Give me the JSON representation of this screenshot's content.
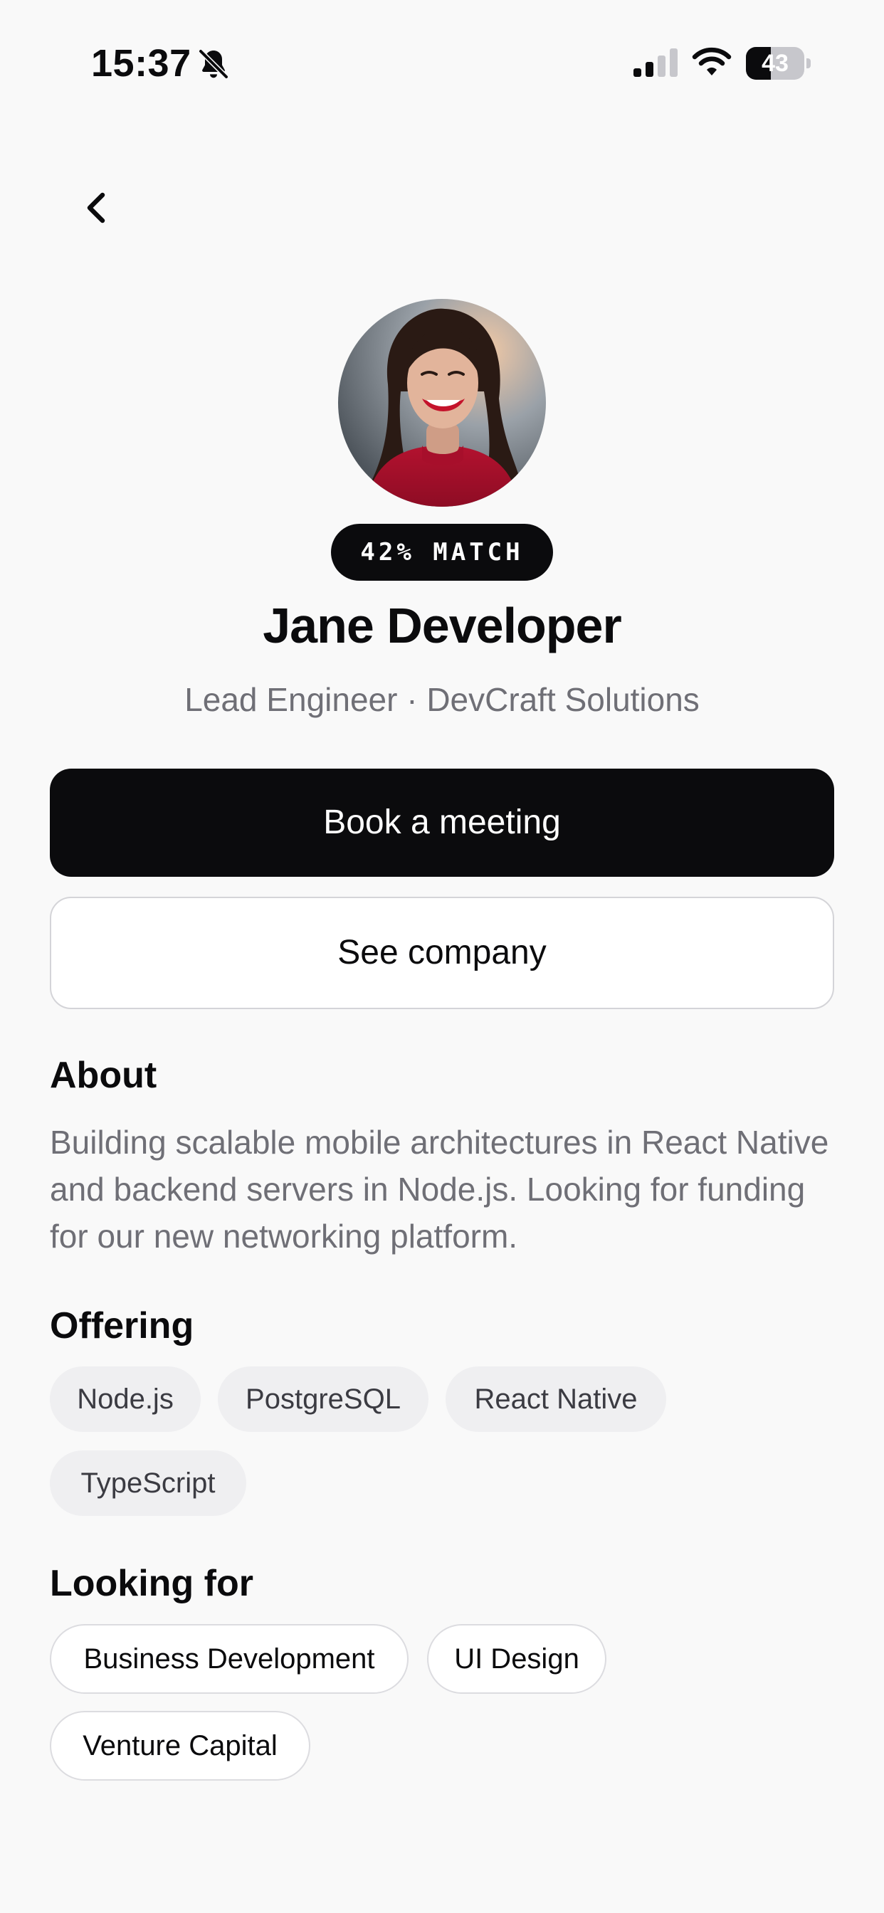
{
  "status_bar": {
    "time": "15:37",
    "battery_level": "43",
    "battery_fraction": 0.43,
    "icons": [
      "bell-slash-icon",
      "cellular-signal-icon",
      "wifi-icon",
      "battery-icon"
    ]
  },
  "navigation": {
    "back_icon": "chevron-left-icon"
  },
  "profile": {
    "avatar": "profile-photo",
    "match_badge": "42% MATCH",
    "name": "Jane Developer",
    "subtitle": "Lead Engineer · DevCraft Solutions"
  },
  "actions": {
    "book_meeting": "Book a meeting",
    "see_company": "See company"
  },
  "about": {
    "heading": "About",
    "text": "Building scalable mobile architectures in React Native and backend servers in Node.js. Looking for funding for our new networking platform."
  },
  "offering": {
    "heading": "Offering",
    "tags": [
      "Node.js",
      "PostgreSQL",
      "React Native",
      "TypeScript"
    ]
  },
  "looking_for": {
    "heading": "Looking for",
    "tags": [
      "Business Development",
      "UI Design",
      "Venture Capital"
    ]
  },
  "colors": {
    "background": "#f9f9f9",
    "primary": "#0b0b0d",
    "muted_text": "#6f6f76",
    "chip_fill": "#efeff1",
    "outline": "#d4d4d8"
  }
}
